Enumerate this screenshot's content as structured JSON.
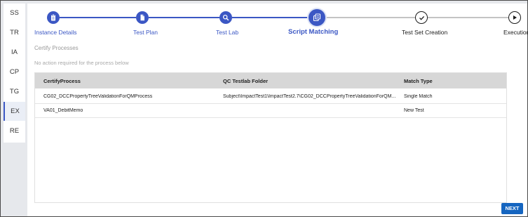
{
  "sidebar": {
    "items": [
      {
        "label": "SS",
        "active": false
      },
      {
        "label": "TR",
        "active": false
      },
      {
        "label": "IA",
        "active": false
      },
      {
        "label": "CP",
        "active": false
      },
      {
        "label": "TG",
        "active": false
      },
      {
        "label": "EX",
        "active": true
      },
      {
        "label": "RE",
        "active": false
      }
    ]
  },
  "stepper": {
    "steps": [
      {
        "label": "Instance Details",
        "icon": "clipboard-icon",
        "state": "completed"
      },
      {
        "label": "Test Plan",
        "icon": "document-icon",
        "state": "completed"
      },
      {
        "label": "Test Lab",
        "icon": "search-icon",
        "state": "completed"
      },
      {
        "label": "Script Matching",
        "icon": "copy-icon",
        "state": "active"
      },
      {
        "label": "Test Set Creation",
        "icon": "check-icon",
        "state": "pending"
      },
      {
        "label": "Execution",
        "icon": "play-icon",
        "state": "pending"
      }
    ]
  },
  "section": {
    "title": "Certify Processes",
    "note": "No action required for the process below"
  },
  "table": {
    "columns": [
      "CertifyProcess",
      "QC Testlab Folder",
      "Match Type"
    ],
    "rows": [
      [
        "CG02_DCCPropertyTreeValidationForQMProcess",
        "Subject\\ImpactTest1\\ImpactTest2.7\\CG02_DCCPropertyTreeValidationForQM...",
        "Single Match"
      ],
      [
        "VA01_DebitMemo",
        "",
        "New Test"
      ]
    ]
  },
  "actions": {
    "next_label": "NEXT"
  },
  "colors": {
    "accent": "#3b57c4",
    "pending": "#1a1a1a",
    "button": "#1565c0"
  }
}
